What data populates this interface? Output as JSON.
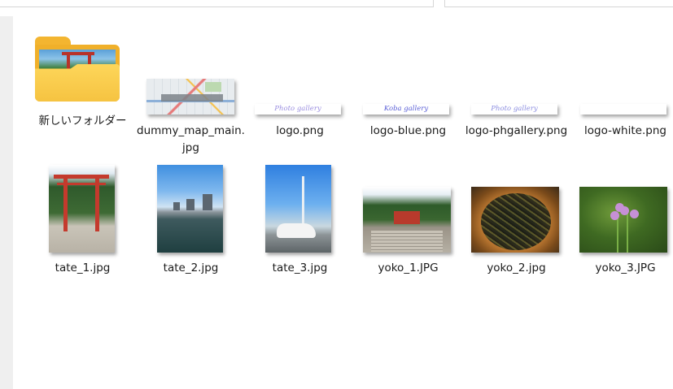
{
  "files": [
    {
      "name": "新しいフォルダー",
      "kind": "folder",
      "icon": "folder-icon"
    },
    {
      "name": "dummy_map_main.jpg",
      "kind": "image"
    },
    {
      "name": "logo.png",
      "kind": "image",
      "logo_text": "Photo gallery",
      "logo_color": "#9b8fe0"
    },
    {
      "name": "logo-blue.png",
      "kind": "image",
      "logo_text": "Koba gallery",
      "logo_color": "#5a5fd6"
    },
    {
      "name": "logo-phgallery.png",
      "kind": "image",
      "logo_text": "Photo gallery",
      "logo_color": "#8c8ee0"
    },
    {
      "name": "logo-white.png",
      "kind": "image",
      "logo_text": "",
      "logo_color": "#ffffff"
    },
    {
      "name": "tate_1.jpg",
      "kind": "image"
    },
    {
      "name": "tate_2.jpg",
      "kind": "image"
    },
    {
      "name": "tate_3.jpg",
      "kind": "image"
    },
    {
      "name": "yoko_1.JPG",
      "kind": "image"
    },
    {
      "name": "yoko_2.jpg",
      "kind": "image"
    },
    {
      "name": "yoko_3.JPG",
      "kind": "image"
    }
  ]
}
